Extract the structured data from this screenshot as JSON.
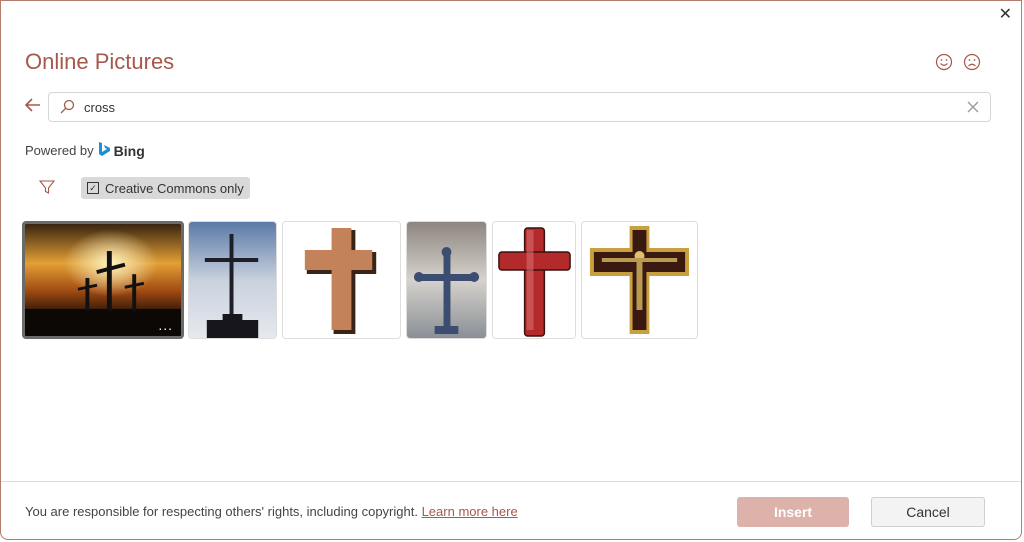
{
  "dialog": {
    "title": "Online Pictures",
    "close_icon": "close-icon",
    "feedback": {
      "smile_icon": "smile-icon",
      "frown_icon": "frown-icon"
    }
  },
  "search": {
    "value": "cross",
    "back_icon": "back-arrow-icon",
    "search_icon": "search-icon",
    "clear_icon": "clear-icon"
  },
  "powered": {
    "label": "Powered by",
    "brand": "Bing"
  },
  "filters": {
    "filter_icon": "filter-icon",
    "cc_label": "Creative Commons only",
    "cc_checked": true
  },
  "results": [
    {
      "name": "three-crosses-sunset",
      "selected": true,
      "more": "..."
    },
    {
      "name": "ornate-iron-cross-sky",
      "selected": false
    },
    {
      "name": "brown-cross-clipart",
      "selected": false
    },
    {
      "name": "blue-standing-cross",
      "selected": false
    },
    {
      "name": "red-cross-clipart",
      "selected": false
    },
    {
      "name": "crucifix-painting",
      "selected": false
    }
  ],
  "footer": {
    "legal": "You are responsible for respecting others' rights, including copyright.",
    "learn_more": "Learn more here",
    "insert": "Insert",
    "cancel": "Cancel"
  },
  "colors": {
    "accent": "#a6584a",
    "insert_disabled": "#dcb2aa"
  }
}
